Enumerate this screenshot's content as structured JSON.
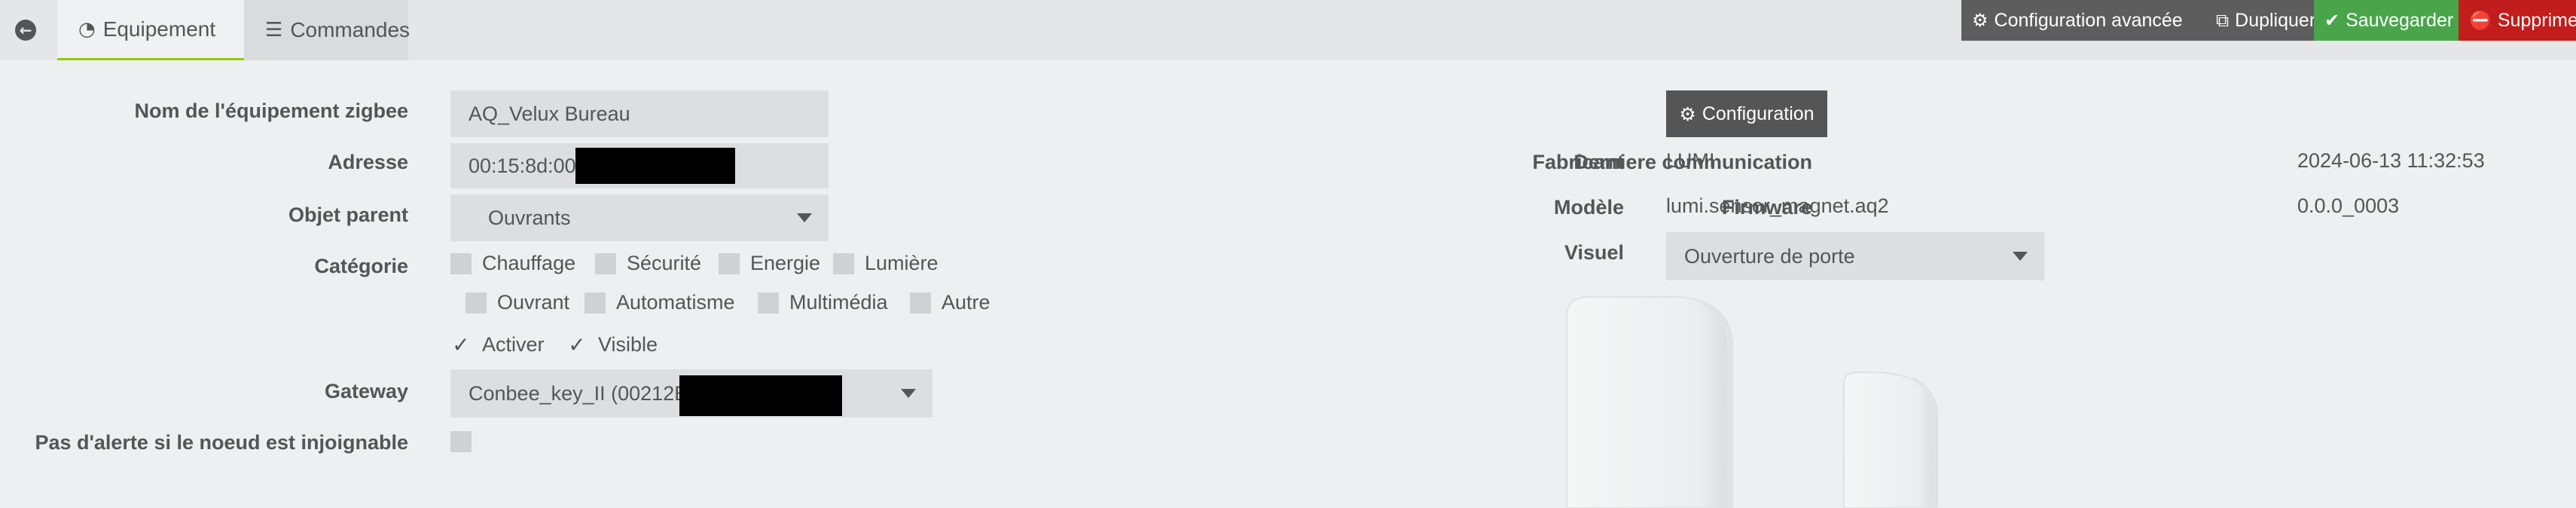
{
  "tabs": {
    "equipement": {
      "label": "Equipement",
      "icon": "dashboard-icon"
    },
    "commandes": {
      "label": "Commandes",
      "icon": "list-icon"
    }
  },
  "actions": {
    "config_avancee": "Configuration avancée",
    "dupliquer": "Dupliquer",
    "sauvegarder": "Sauvegarder",
    "supprimer": "Supprimer"
  },
  "form": {
    "nom_label": "Nom de l'équipement zigbee",
    "nom_value": "AQ_Velux Bureau",
    "adresse_label": "Adresse",
    "adresse_value": "00:15:8d:00",
    "objet_label": "Objet parent",
    "objet_value": "Ouvrants",
    "categorie_label": "Catégorie",
    "categories": [
      "Chauffage",
      "Sécurité",
      "Energie",
      "Lumière",
      "Ouvrant",
      "Automatisme",
      "Multimédia",
      "Autre"
    ],
    "activer": "Activer",
    "visible": "Visible",
    "gateway_label": "Gateway",
    "gateway_value": "Conbee_key_II (00212E",
    "alerte_label": "Pas d'alerte si le noeud est injoignable"
  },
  "info": {
    "config_button": "Configuration",
    "fabricant_label": "Fabricant",
    "fabricant_value": "LUMI",
    "modele_label": "Modèle",
    "modele_value": "lumi.sensor_magnet.aq2",
    "visuel_label": "Visuel",
    "visuel_value": "Ouverture de porte",
    "derniere_label": "Derniere communication",
    "derniere_value": "2024-06-13 11:32:53",
    "firmware_label": "Firmware",
    "firmware_value": "0.0.0_0003"
  },
  "colors": {
    "accent_green": "#93ca02",
    "save_green": "#4aa54a",
    "delete_red": "#c21d1d",
    "dark_button": "#5d5d5d"
  }
}
